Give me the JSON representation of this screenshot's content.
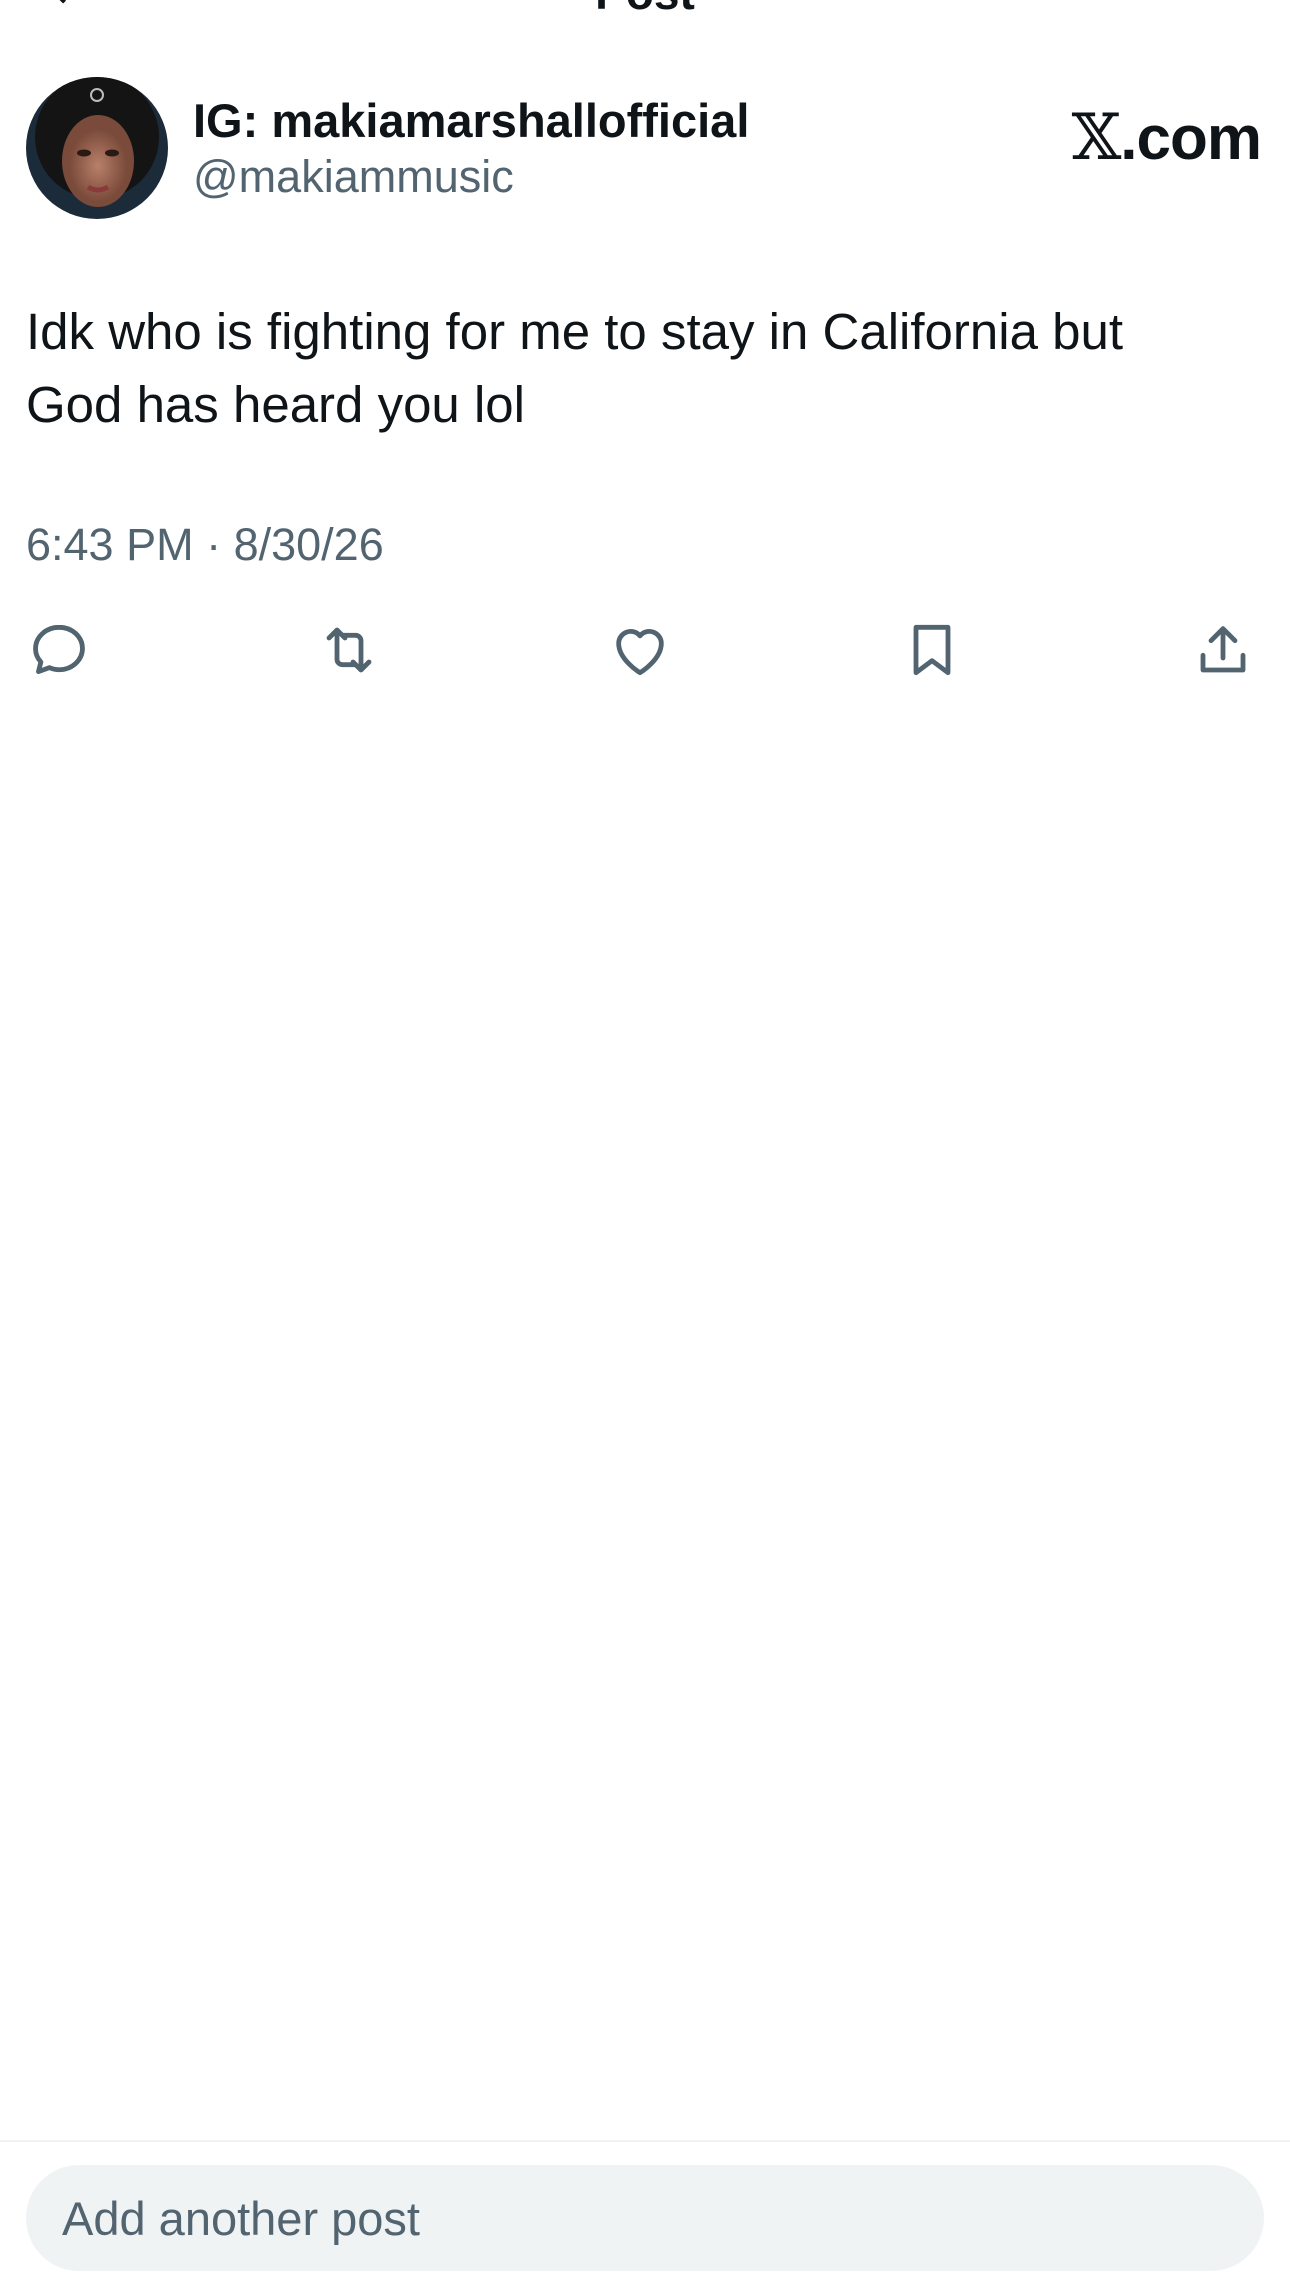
{
  "header": {
    "title": "Post",
    "back_icon": "arrow-left-icon"
  },
  "author": {
    "display_name": "IG: makiamarshallofficial",
    "handle": "@makiammusic",
    "avatar": "avatar-photo"
  },
  "brand": {
    "x_glyph": "𝕏",
    "suffix": ".com"
  },
  "post": {
    "text": "Idk who is fighting for me to stay in California but\nGod has heard you lol",
    "timestamp": "6:43 PM · 8/30/26"
  },
  "actions": [
    {
      "name": "reply",
      "icon": "reply-icon"
    },
    {
      "name": "repost",
      "icon": "repost-icon"
    },
    {
      "name": "like",
      "icon": "heart-icon"
    },
    {
      "name": "bookmark",
      "icon": "bookmark-icon"
    },
    {
      "name": "share",
      "icon": "share-icon"
    }
  ],
  "composer": {
    "placeholder": "Add another post",
    "value": ""
  },
  "colors": {
    "text_primary": "#0f1419",
    "text_secondary": "#536471",
    "composer_bg": "#eff3f4"
  }
}
